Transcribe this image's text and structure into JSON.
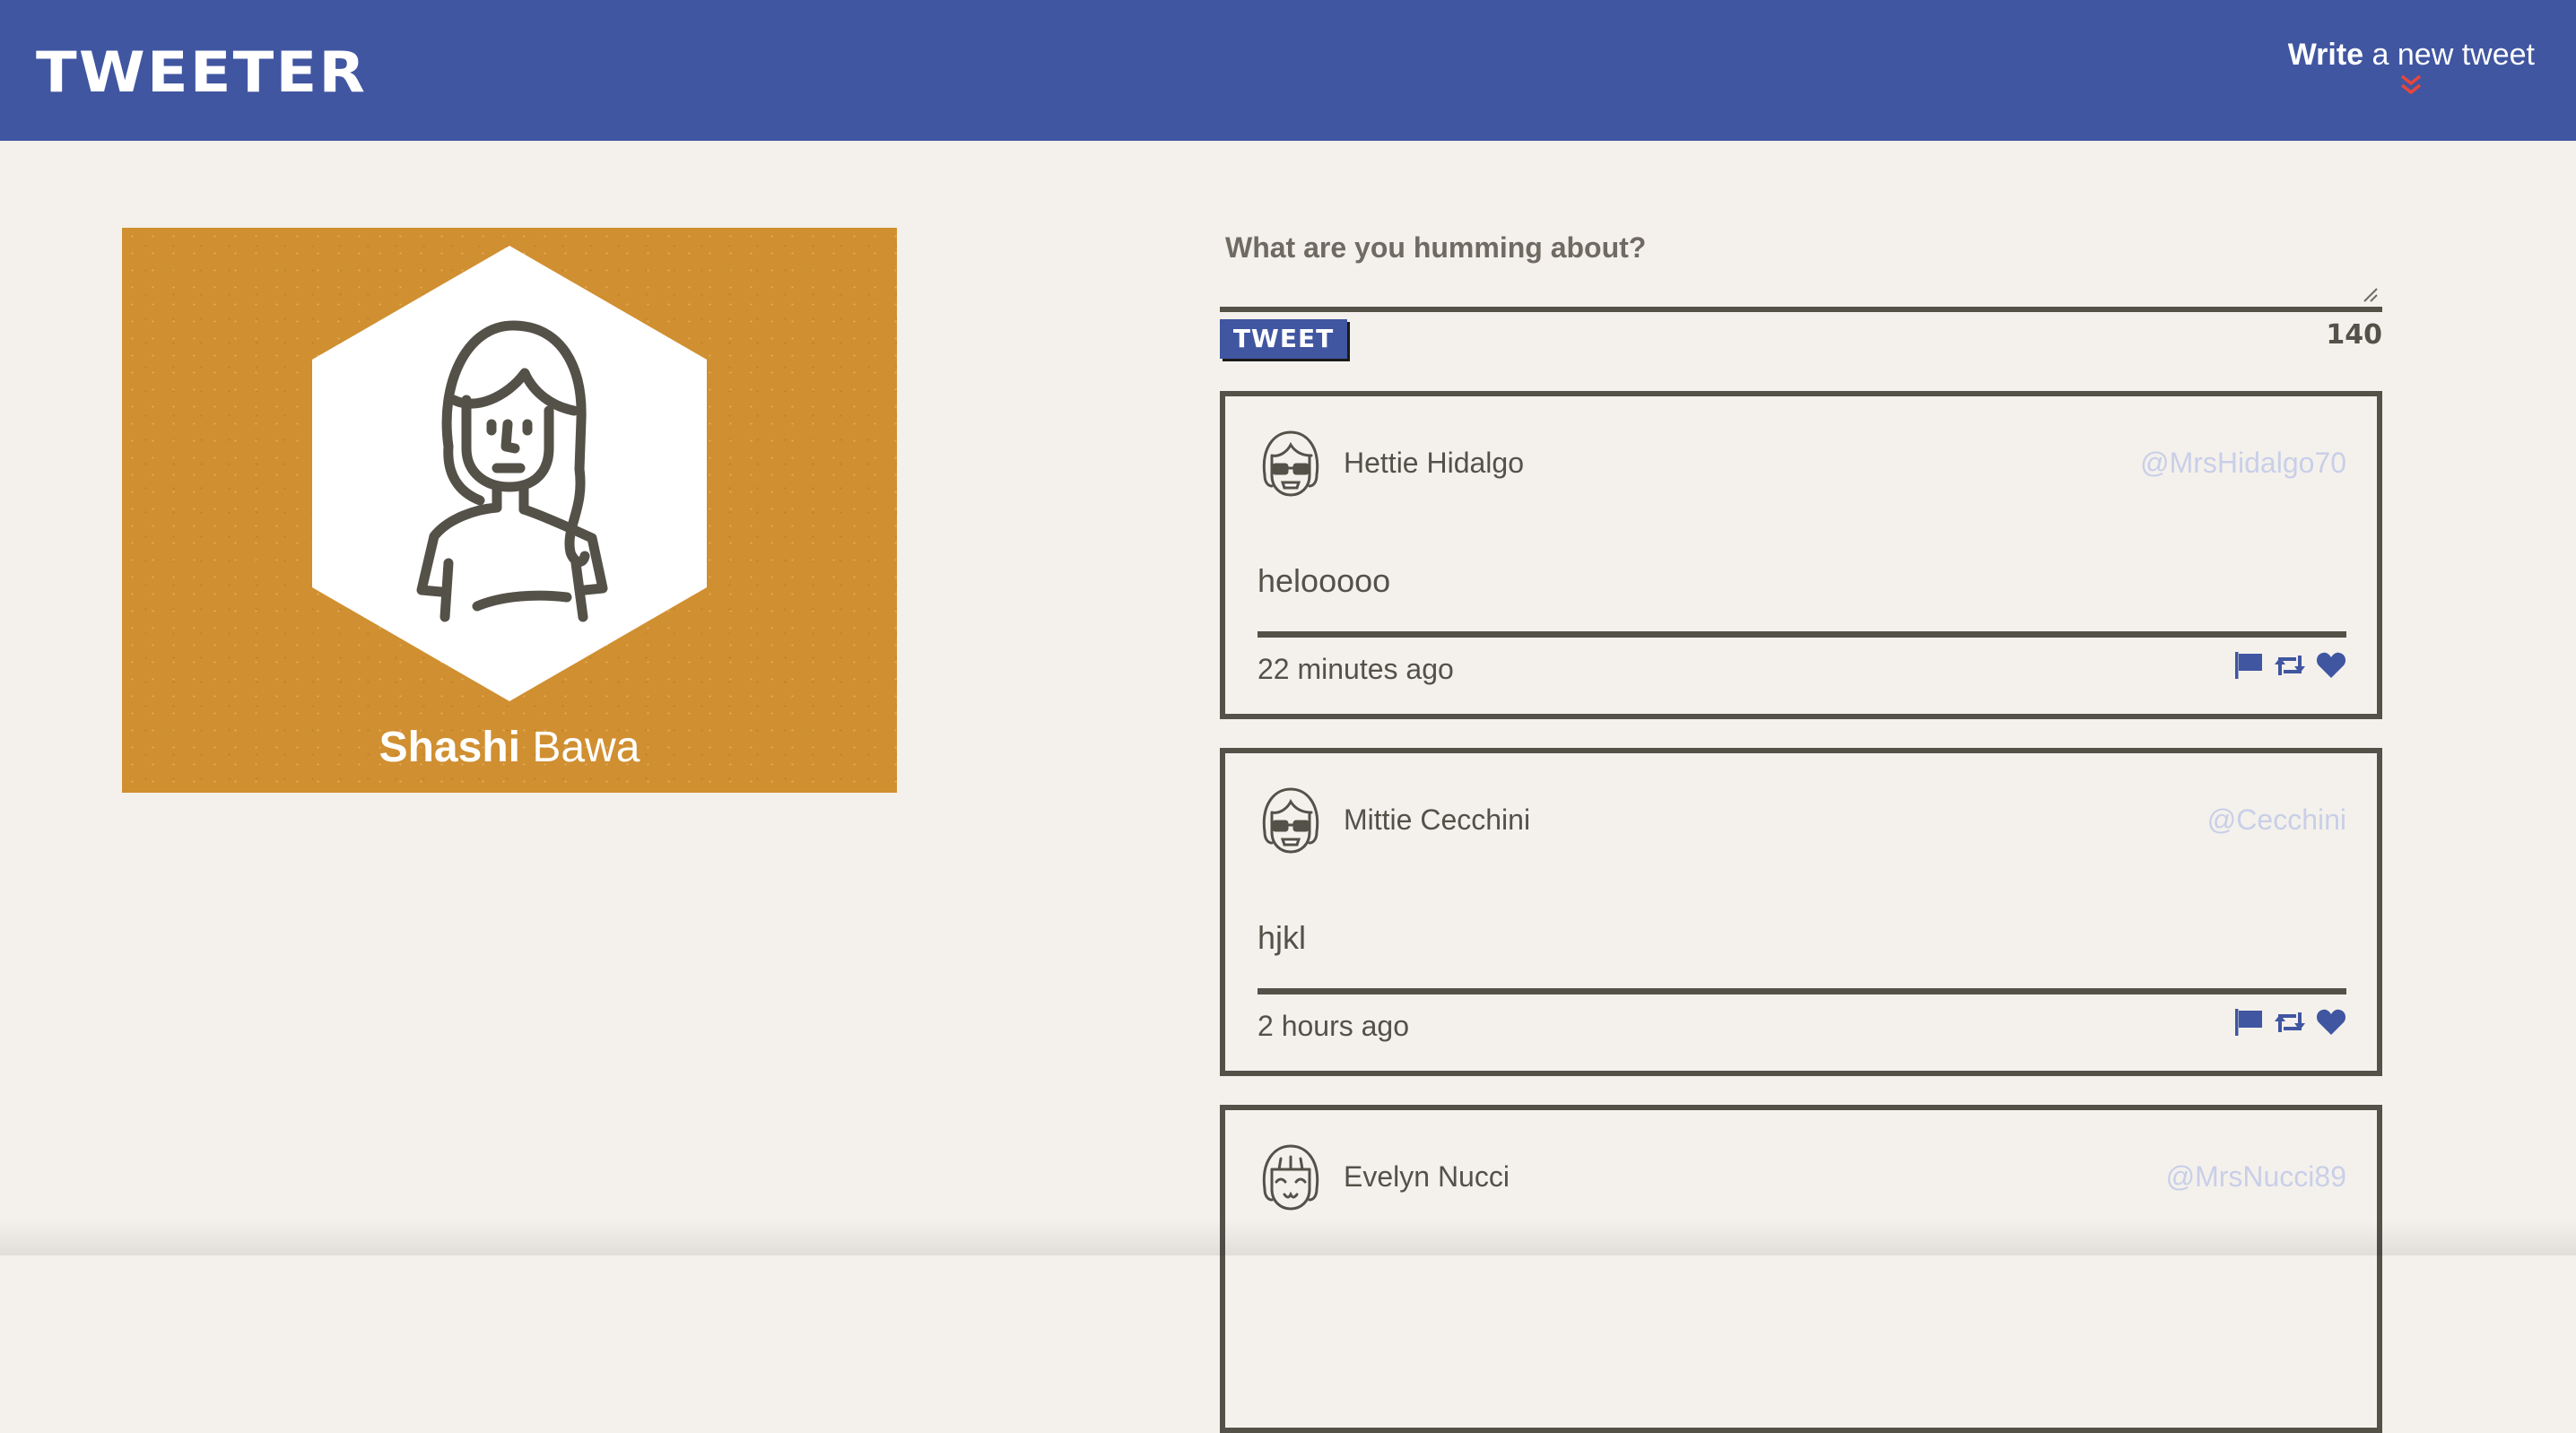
{
  "nav": {
    "brand": "TWEETER",
    "compose_bold": "Write",
    "compose_rest": "a new tweet",
    "compose_icon": "double-chevron-down-icon"
  },
  "profile": {
    "first_name": "Shashi",
    "last_name": "Bawa",
    "background_color": "#d08f31"
  },
  "composer": {
    "placeholder": "What are you humming about?",
    "button_label": "TWEET",
    "counter": "140"
  },
  "tweets": [
    {
      "name": "Hettie Hidalgo",
      "handle": "@MrsHidalgo70",
      "content": "helooooo",
      "time": "22 minutes ago",
      "avatar": "girl-glasses-avatar"
    },
    {
      "name": "Mittie Cecchini",
      "handle": "@Cecchini",
      "content": "hjkl",
      "time": "2 hours ago",
      "avatar": "girl-glasses-avatar"
    },
    {
      "name": "Evelyn Nucci",
      "handle": "@MrsNucci89",
      "content": "",
      "time": "",
      "avatar": "girl-smiling-avatar"
    }
  ],
  "colors": {
    "nav": "#4056a1",
    "background": "#f4f1ec",
    "accent_red": "#e8463d",
    "text": "#545149",
    "handle": "#c9cfe8",
    "profile": "#d08f31"
  },
  "icons": {
    "flag": "flag-icon",
    "retweet": "retweet-icon",
    "like": "heart-icon"
  }
}
